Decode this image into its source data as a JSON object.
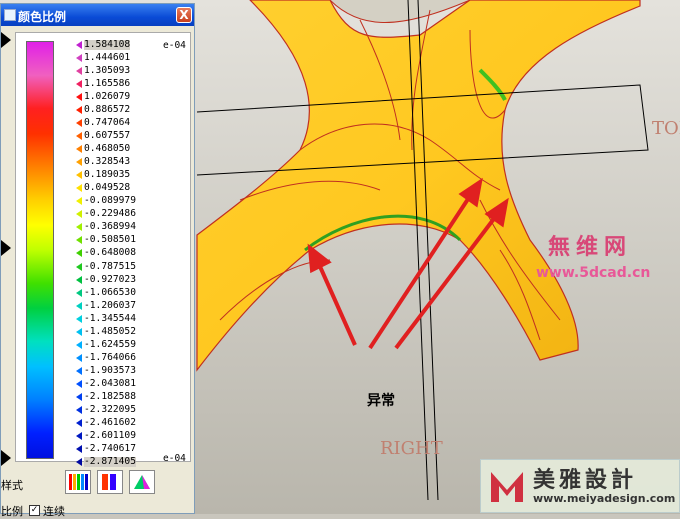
{
  "panel": {
    "title": "颜色比例",
    "close_label": "X",
    "exponent_top": "e-04",
    "exponent_bottom": "e-04",
    "scale_values": [
      "1.584108",
      "1.444601",
      "1.305093",
      "1.165586",
      "1.026079",
      "0.886572",
      "0.747064",
      "0.607557",
      "0.468050",
      "0.328543",
      "0.189035",
      "0.049528",
      "-0.089979",
      "-0.229486",
      "-0.368994",
      "-0.508501",
      "-0.648008",
      "-0.787515",
      "-0.927023",
      "-1.066530",
      "-1.206037",
      "-1.345544",
      "-1.485052",
      "-1.624559",
      "-1.764066",
      "-1.903573",
      "-2.043081",
      "-2.182588",
      "-2.322095",
      "-2.461602",
      "-2.601109",
      "-2.740617",
      "-2.871405"
    ],
    "marker_colors": [
      "#c020d0",
      "#d040c0",
      "#e040a0",
      "#f02060",
      "#ff1010",
      "#ff2000",
      "#ff4000",
      "#ff6000",
      "#ff8000",
      "#ffa000",
      "#ffc000",
      "#ffe000",
      "#f0f000",
      "#d0f000",
      "#a0f000",
      "#70e000",
      "#40d000",
      "#20c820",
      "#00c040",
      "#00c880",
      "#00d0c0",
      "#00d0e0",
      "#00c0f0",
      "#00b0ff",
      "#0090ff",
      "#0070ff",
      "#0050ff",
      "#0040f0",
      "#0030e0",
      "#0020d0",
      "#0018c0",
      "#0010b0",
      "#0008a0"
    ],
    "style_label": "样式",
    "ratio_label": "比例",
    "link_label": "连续"
  },
  "viewport": {
    "annotation": "异常",
    "view_label_top": "TOP",
    "view_label_right": "RIGHT"
  },
  "watermark": {
    "logo_text": "無维网",
    "logo_url": "www.5dcad.cn",
    "brand": "美雅設計",
    "brand_url": "www.meiyadesign.com"
  }
}
